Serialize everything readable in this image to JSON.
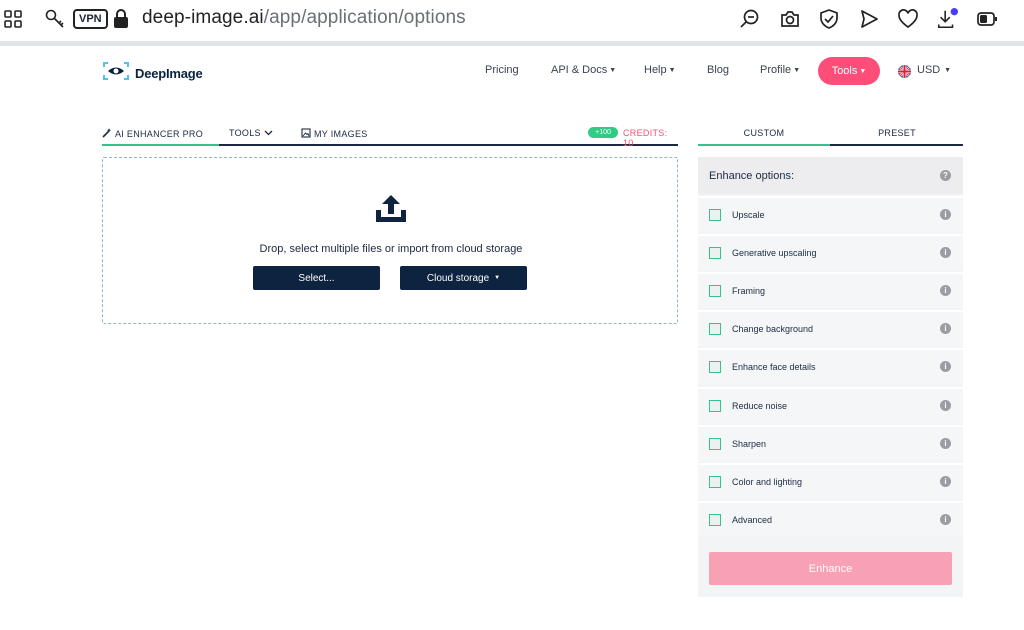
{
  "browser": {
    "vpn_label": "VPN",
    "url_host": "deep-image.ai",
    "url_path": "/app/application/options",
    "icons": [
      "apps-grid-icon",
      "key-icon",
      "lock-icon",
      "search-zoom-icon",
      "camera-icon",
      "shield-check-icon",
      "send-icon",
      "heart-icon",
      "download-icon",
      "battery-icon"
    ]
  },
  "site": {
    "logo_text": "DeepImage",
    "nav": {
      "pricing": "Pricing",
      "api_docs": "API & Docs",
      "help": "Help",
      "blog": "Blog",
      "profile": "Profile",
      "tools": "Tools",
      "currency": "USD"
    },
    "accent_color": "#ff4d79"
  },
  "left_tabs": {
    "ai_enhancer": "AI ENHANCER PRO",
    "tools": "TOOLS",
    "my_images": "MY IMAGES",
    "credit_badge": "+100",
    "credits": "CREDITS: 10"
  },
  "dropzone": {
    "text": "Drop, select multiple files or import from cloud storage",
    "select_button": "Select...",
    "cloud_button": "Cloud storage"
  },
  "right_tabs": {
    "custom": "CUSTOM",
    "preset": "PRESET"
  },
  "panel": {
    "title": "Enhance options:",
    "help": "?",
    "info": "i",
    "options": [
      {
        "label": "Upscale"
      },
      {
        "label": "Generative upscaling"
      },
      {
        "label": "Framing"
      },
      {
        "label": "Change background"
      },
      {
        "label": "Enhance face details"
      },
      {
        "label": "Reduce noise"
      },
      {
        "label": "Sharpen"
      },
      {
        "label": "Color and lighting"
      },
      {
        "label": "Advanced"
      }
    ],
    "enhance_button": "Enhance"
  }
}
